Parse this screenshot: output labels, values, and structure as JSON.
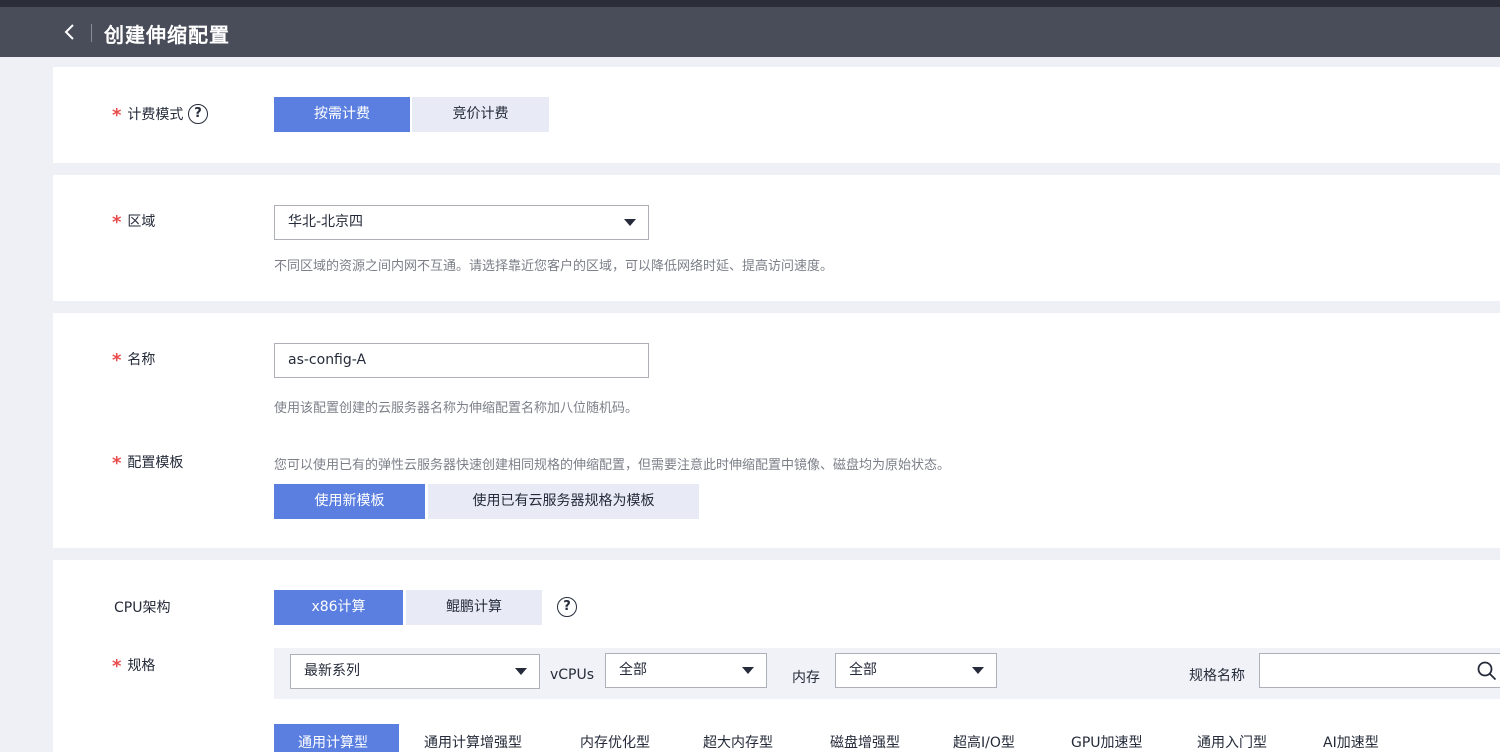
{
  "header": {
    "title": "创建伸缩配置"
  },
  "billing": {
    "label": "计费模式",
    "options": [
      "按需计费",
      "竞价计费"
    ]
  },
  "region": {
    "label": "区域",
    "value": "华北-北京四",
    "hint": "不同区域的资源之间内网不互通。请选择靠近您客户的区域，可以降低网络时延、提高访问速度。"
  },
  "name": {
    "label": "名称",
    "value": "as-config-A",
    "hint": "使用该配置创建的云服务器名称为伸缩配置名称加八位随机码。"
  },
  "template": {
    "label": "配置模板",
    "hint": "您可以使用已有的弹性云服务器快速创建相同规格的伸缩配置，但需要注意此时伸缩配置中镜像、磁盘均为原始状态。",
    "options": [
      "使用新模板",
      "使用已有云服务器规格为模板"
    ]
  },
  "cpu": {
    "label": "CPU架构",
    "options": [
      "x86计算",
      "鲲鹏计算"
    ]
  },
  "spec": {
    "label": "规格",
    "series_value": "最新系列",
    "vcpus_label": "vCPUs",
    "vcpus_value": "全部",
    "memory_label": "内存",
    "memory_value": "全部",
    "name_label": "规格名称",
    "name_value": "",
    "tabs": [
      "通用计算型",
      "通用计算增强型",
      "内存优化型",
      "超大内存型",
      "磁盘增强型",
      "超高I/O型",
      "GPU加速型",
      "通用入门型",
      "AI加速型"
    ]
  },
  "colors": {
    "accent": "#5b7fe0",
    "header_bg": "#494c59",
    "required": "#e84b4b"
  }
}
